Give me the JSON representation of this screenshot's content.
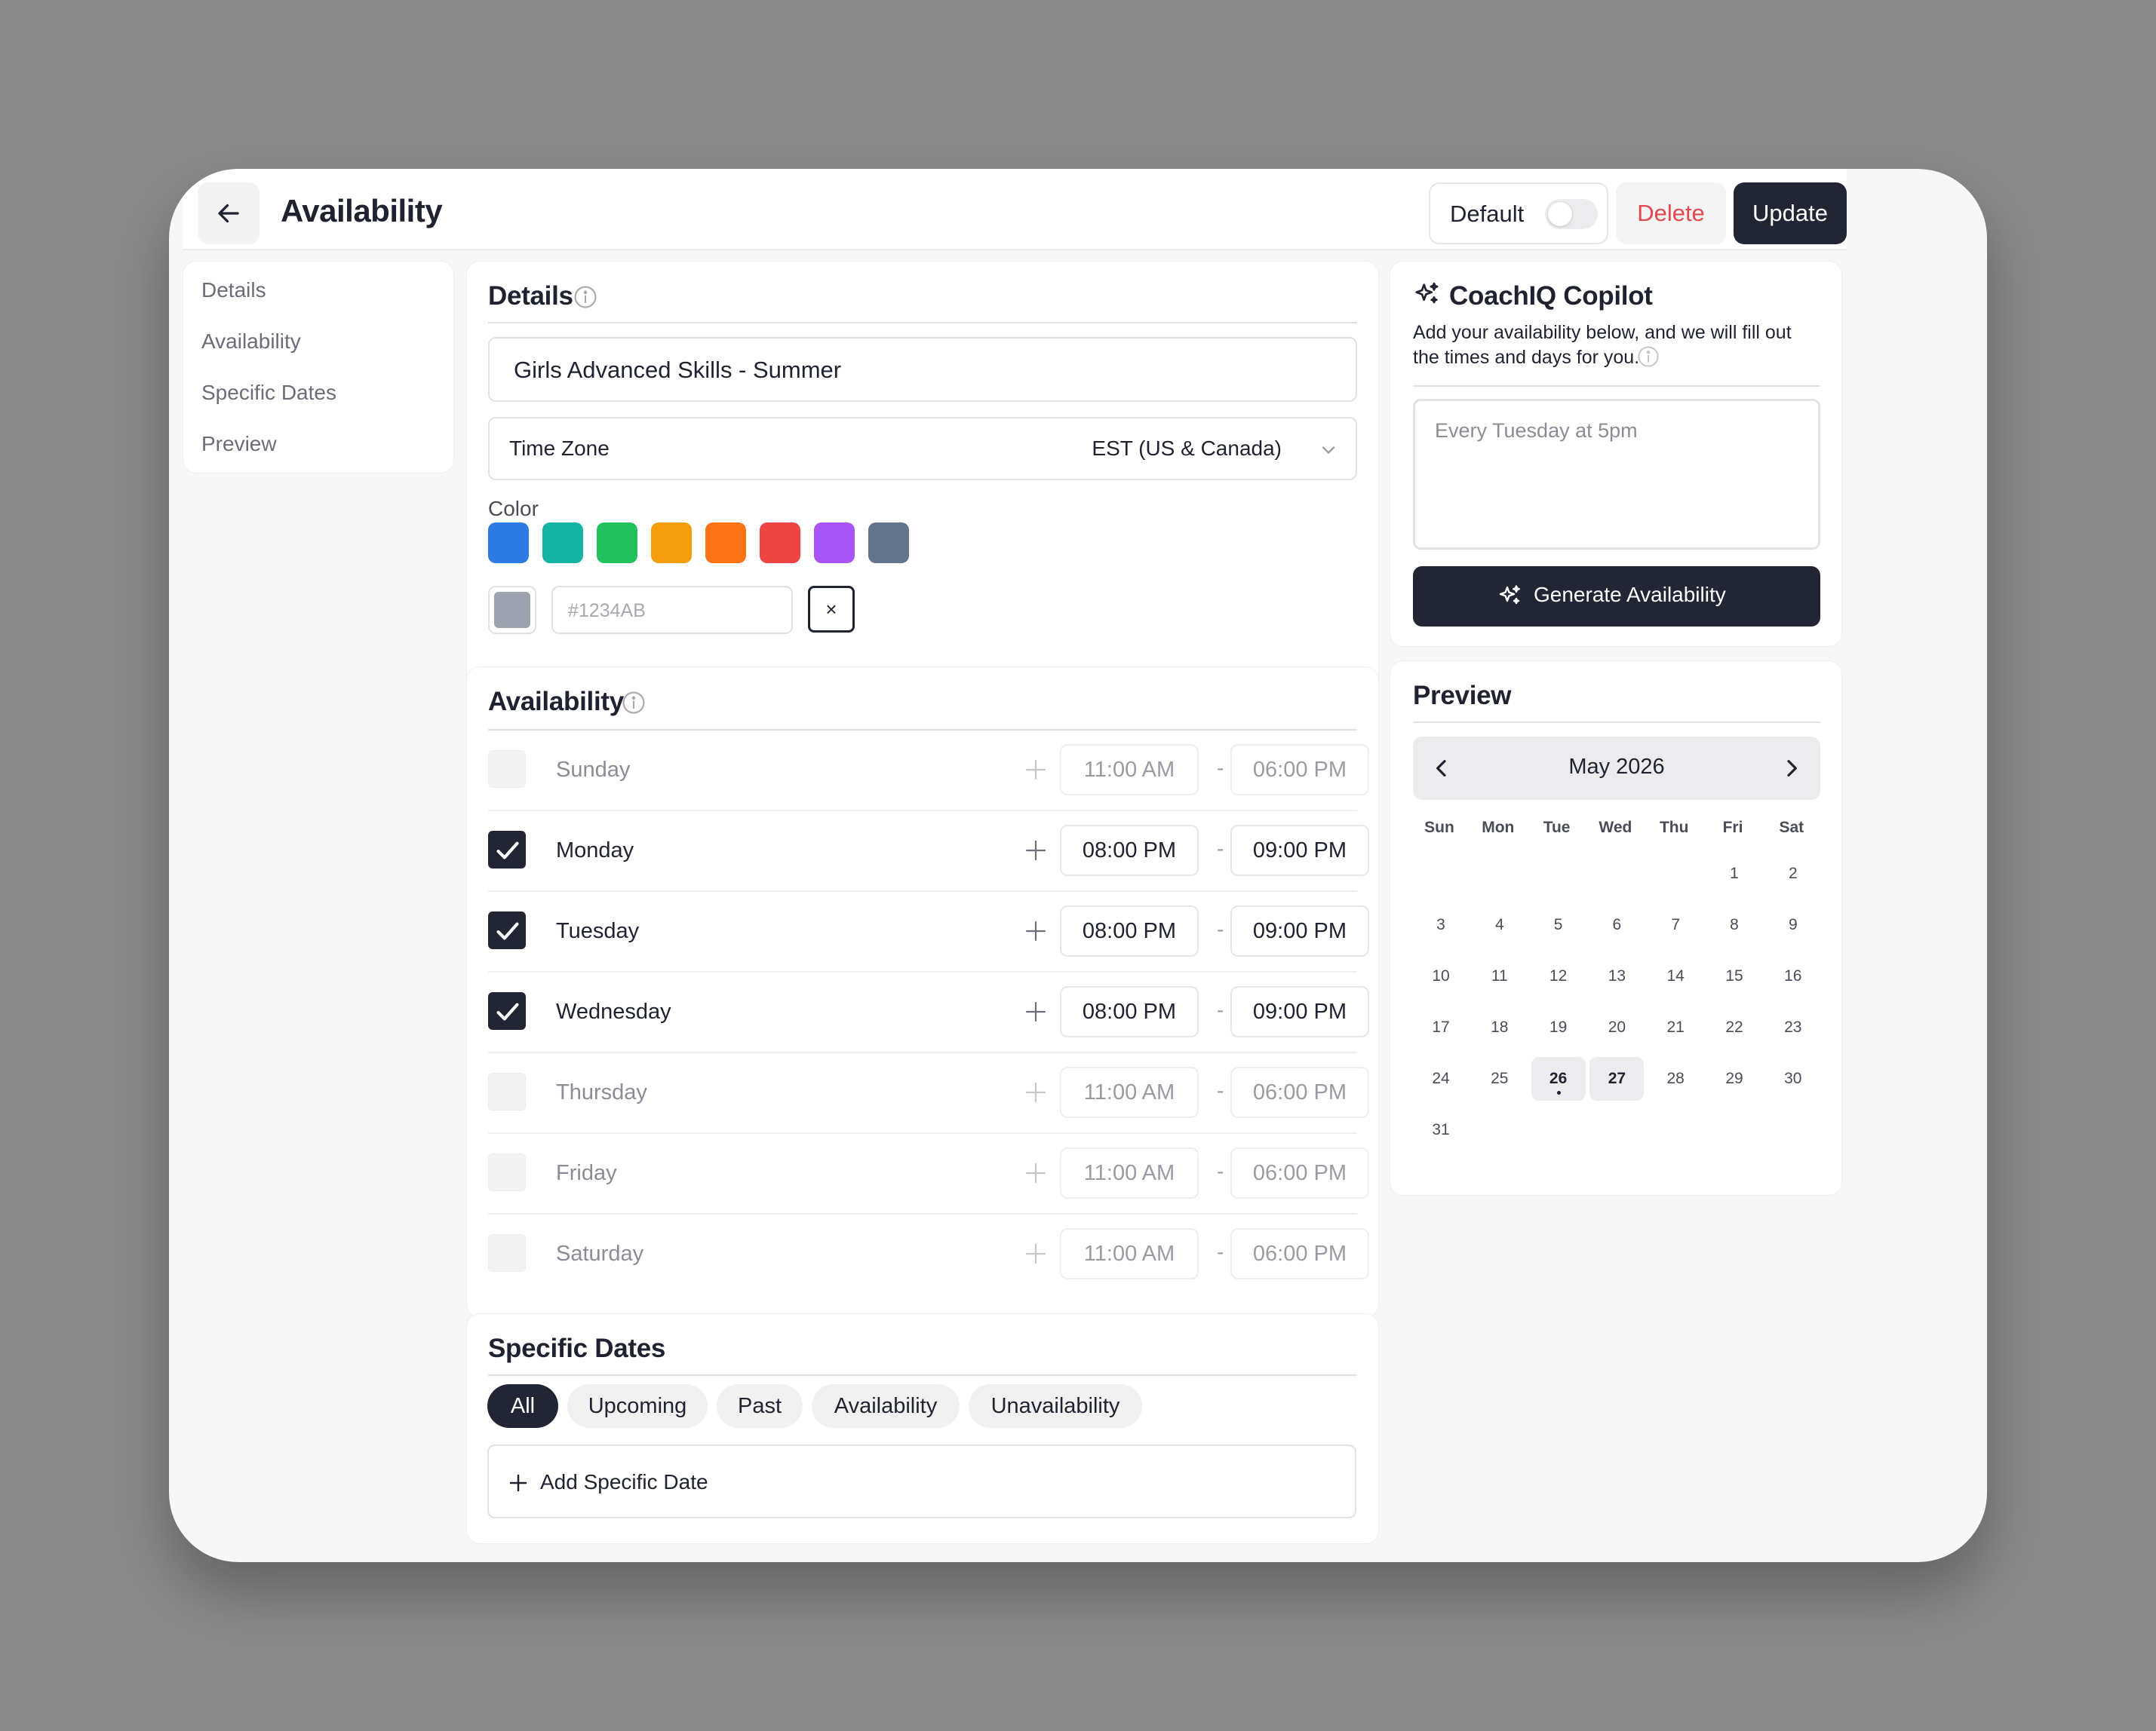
{
  "header": {
    "title": "Availability",
    "default_label": "Default",
    "delete_label": "Delete",
    "update_label": "Update"
  },
  "sidebar": {
    "items": [
      "Details",
      "Availability",
      "Specific Dates",
      "Preview"
    ]
  },
  "details": {
    "title": "Details",
    "name_value": "Girls Advanced Skills - Summer",
    "timezone_label": "Time Zone",
    "timezone_value": "EST (US & Canada)",
    "color_label": "Color",
    "swatches": [
      "#2f7be6",
      "#14b3a4",
      "#22c15e",
      "#f59e0b",
      "#f97316",
      "#ef4444",
      "#a855f7",
      "#64748b"
    ],
    "custom_color": "#9ca3af",
    "hex_placeholder": "#1234AB",
    "clear_label": "×"
  },
  "availability": {
    "title": "Availability",
    "days": [
      {
        "name": "Sunday",
        "checked": false,
        "start": "11:00 AM",
        "end": "06:00 PM"
      },
      {
        "name": "Monday",
        "checked": true,
        "start": "08:00 PM",
        "end": "09:00 PM"
      },
      {
        "name": "Tuesday",
        "checked": true,
        "start": "08:00 PM",
        "end": "09:00 PM"
      },
      {
        "name": "Wednesday",
        "checked": true,
        "start": "08:00 PM",
        "end": "09:00 PM"
      },
      {
        "name": "Thursday",
        "checked": false,
        "start": "11:00 AM",
        "end": "06:00 PM"
      },
      {
        "name": "Friday",
        "checked": false,
        "start": "11:00 AM",
        "end": "06:00 PM"
      },
      {
        "name": "Saturday",
        "checked": false,
        "start": "11:00 AM",
        "end": "06:00 PM"
      }
    ],
    "dash": "-"
  },
  "specific_dates": {
    "title": "Specific Dates",
    "filters": [
      "All",
      "Upcoming",
      "Past",
      "Availability",
      "Unavailability"
    ],
    "active_filter": "All",
    "add_label": "Add Specific Date"
  },
  "copilot": {
    "title": "CoachIQ Copilot",
    "description_line1": "Add your availability below, and we will fill out",
    "description_line2": "the times and days for you.",
    "prompt_placeholder": "Every Tuesday at 5pm",
    "generate_label": "Generate Availability"
  },
  "preview": {
    "title": "Preview",
    "month_label": "May 2026",
    "weekdays": [
      "Sun",
      "Mon",
      "Tue",
      "Wed",
      "Thu",
      "Fri",
      "Sat"
    ],
    "weeks": [
      [
        "",
        "",
        "",
        "",
        "",
        "1",
        "2"
      ],
      [
        "3",
        "4",
        "5",
        "6",
        "7",
        "8",
        "9"
      ],
      [
        "10",
        "11",
        "12",
        "13",
        "14",
        "15",
        "16"
      ],
      [
        "17",
        "18",
        "19",
        "20",
        "21",
        "22",
        "23"
      ],
      [
        "24",
        "25",
        "26",
        "27",
        "28",
        "29",
        "30"
      ],
      [
        "31",
        "",
        "",
        "",
        "",
        "",
        ""
      ]
    ],
    "highlighted_days": [
      "26",
      "27"
    ],
    "today": "26"
  }
}
